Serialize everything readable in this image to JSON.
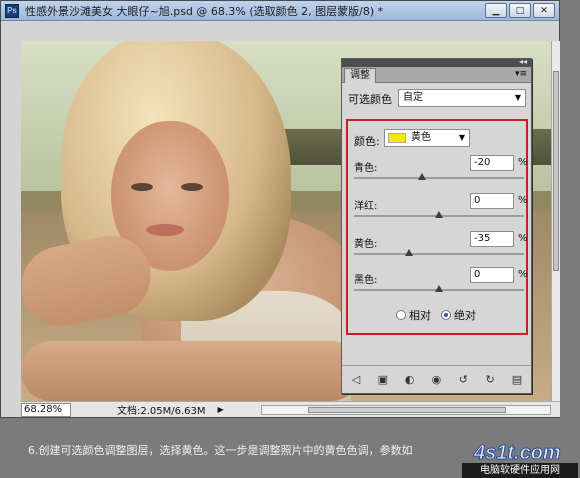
{
  "window": {
    "title": "性感外景沙滩美女  大眼仔~旭.psd @ 68.3% (选取颜色 2, 图层蒙版/8) *",
    "app_icon_text": "Ps",
    "minimize_glyph": "▁",
    "maximize_glyph": "□",
    "close_glyph": "✕"
  },
  "status": {
    "zoom": "68.28%",
    "doc": "文档:2.05M/6.63M",
    "arrow": "▶"
  },
  "panel": {
    "collapse_glyph": "◂◂",
    "tab": "调整",
    "menu_glyph": "▾≡",
    "selective_label": "可选颜色",
    "preset": "自定",
    "color_label": "颜色:",
    "color_value": "黄色",
    "color_swatch": "#f1ea00",
    "sliders": [
      {
        "label": "青色:",
        "value": "-20",
        "unit": "%",
        "level": -20
      },
      {
        "label": "洋红:",
        "value": "0",
        "unit": "%",
        "level": 0
      },
      {
        "label": "黄色:",
        "value": "-35",
        "unit": "%",
        "level": -35
      },
      {
        "label": "黑色:",
        "value": "0",
        "unit": "%",
        "level": 0
      }
    ],
    "method": {
      "relative": "相对",
      "absolute": "绝对",
      "selected": "absolute"
    },
    "tool_icons": [
      "back-arrow-icon",
      "layer-icon",
      "clip-icon",
      "eye-icon",
      "view-previous-icon",
      "reset-icon",
      "trash-icon"
    ]
  },
  "caption": "6.创建可选颜色调整图层，选择黄色。这一步是调整照片中的黄色色调，参数如",
  "watermark": {
    "logo": "4s1t.com",
    "sub": "电脑软硬件应用网"
  }
}
